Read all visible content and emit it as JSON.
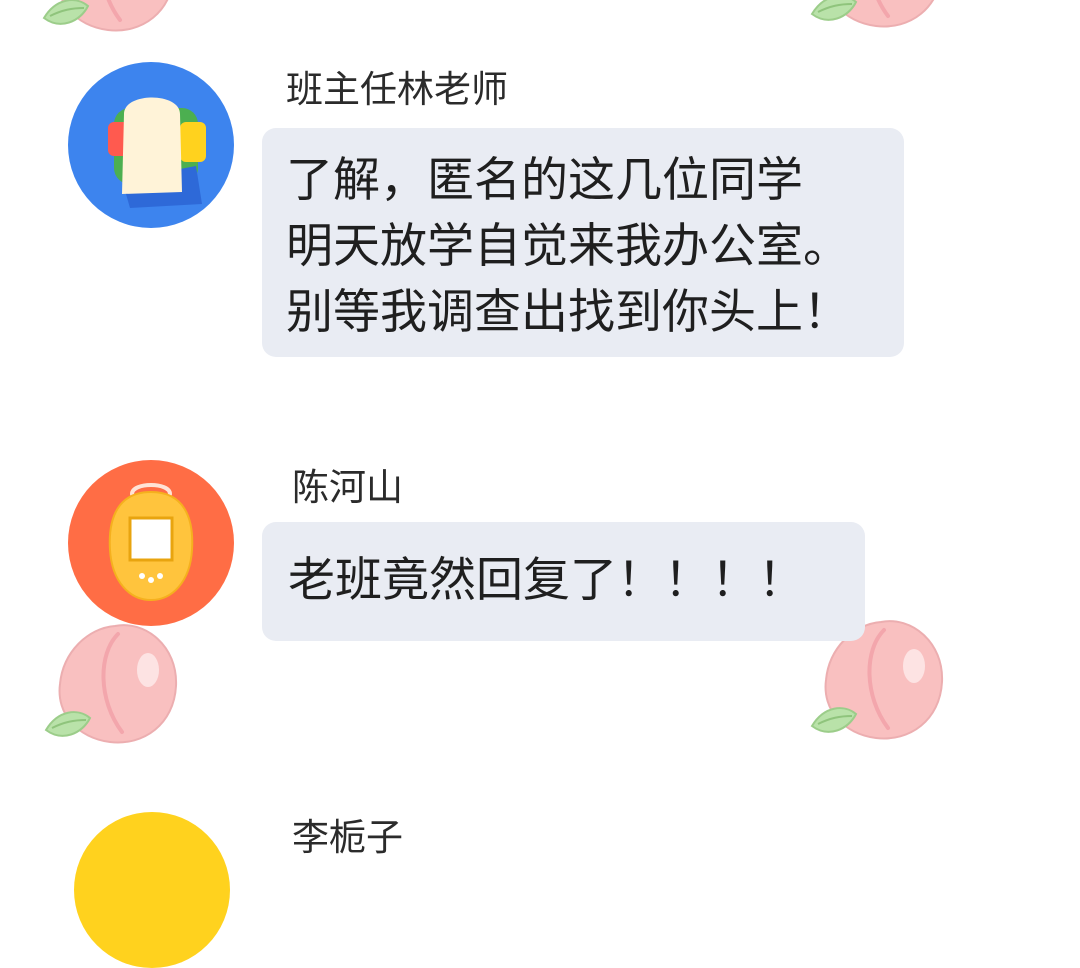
{
  "messages": [
    {
      "sender": "班主任林老师",
      "avatar": "sandwich-icon",
      "avatar_color": "#3d84ee",
      "lines": [
        "了解，匿名的这几位同学",
        "明天放学自觉来我办公室。",
        "别等我调查出找到你头上！"
      ]
    },
    {
      "sender": "陈河山",
      "avatar": "handheld-game-icon",
      "avatar_color": "#ff6d45",
      "lines": [
        "老班竟然回复了！！！！"
      ]
    },
    {
      "sender": "李栀子",
      "avatar": "yellow-avatar",
      "avatar_color": "#ffd21e",
      "lines": []
    }
  ],
  "colors": {
    "bubble_background": "#e9ecf3",
    "peach": "#f9c0c0",
    "leaf": "#b9e2a9"
  },
  "decorations": [
    "peach-icon"
  ]
}
